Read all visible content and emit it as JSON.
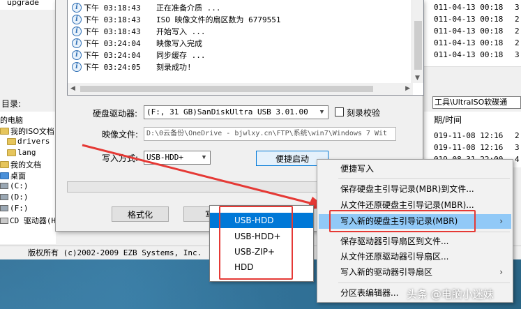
{
  "background_window": {
    "top_left_label": "upgrade",
    "dir_label": "目录:",
    "path_text": "工具\\UltraISO软碟通",
    "files_top": [
      {
        "date": "011-04-13 00:18",
        "cut": "3"
      },
      {
        "date": "011-04-13 00:18",
        "cut": "2"
      },
      {
        "date": "011-04-13 00:18",
        "cut": "2"
      },
      {
        "date": "011-04-13 00:18",
        "cut": "2"
      },
      {
        "date": "011-04-13 00:18",
        "cut": "3"
      }
    ],
    "col_date": "期/时间",
    "files_bottom": [
      {
        "date": "019-11-08 12:16",
        "cut": "2"
      },
      {
        "date": "019-11-08 12:16",
        "cut": "3"
      },
      {
        "date": "019-08-31 22:00",
        "cut": "4"
      }
    ],
    "tree": [
      {
        "label": "的电脑",
        "icon": "computer-icon"
      },
      {
        "label": "我的ISO文档",
        "icon": "folder-icon"
      },
      {
        "label": "drivers",
        "icon": "folder-icon"
      },
      {
        "label": "lang",
        "icon": "folder-icon"
      },
      {
        "label": "我的文档",
        "icon": "folder-icon"
      },
      {
        "label": "桌面",
        "icon": "desktop-icon"
      },
      {
        "label": "(C:)",
        "icon": "drive-icon"
      },
      {
        "label": "(D:)",
        "icon": "drive-icon"
      },
      {
        "label": "(F:)",
        "icon": "drive-icon"
      },
      {
        "label": "CD 驱动器(H",
        "icon": "cd-drive-icon"
      }
    ],
    "status": "版权所有 (c)2002-2009 EZB Systems, Inc."
  },
  "dialog": {
    "log": [
      {
        "time": "下午 03:18:43",
        "msg": "正在准备介质 ..."
      },
      {
        "time": "下午 03:18:43",
        "msg": "ISO 映像文件的扇区数为 6779551"
      },
      {
        "time": "下午 03:18:43",
        "msg": "开始写入 ..."
      },
      {
        "time": "下午 03:24:04",
        "msg": "映像写入完成"
      },
      {
        "time": "下午 03:24:04",
        "msg": "同步缓存 ..."
      },
      {
        "time": "下午 03:24:05",
        "msg": "刻录成功!"
      }
    ],
    "drive_label": "硬盘驱动器:",
    "drive_value": "(F:, 31 GB)SanDiskUltra USB 3.01.00",
    "verify_label": "刻录校验",
    "image_label": "映像文件:",
    "image_value": "D:\\0云备份\\OneDrive - bjwlxy.cn\\FTP\\系统\\win7\\Windows 7 Wit",
    "write_mode_label": "写入方式:",
    "write_mode_value": "USB-HDD+",
    "quick_boot_btn": "便捷启动",
    "format_btn": "格式化",
    "write_btn_partial": "写"
  },
  "write_mode_popup": {
    "options": [
      "USB-HDD",
      "USB-HDD+",
      "USB-ZIP+",
      "HDD"
    ],
    "selected": "USB-HDD"
  },
  "context_menu": {
    "items": [
      {
        "label": "便捷写入",
        "submenu": false
      },
      {
        "label": "保存硬盘主引导记录(MBR)到文件...",
        "submenu": false
      },
      {
        "label": "从文件还原硬盘主引导记录(MBR)...",
        "submenu": false
      },
      {
        "label": "写入新的硬盘主引导记录(MBR)",
        "submenu": true
      },
      {
        "label": "保存驱动器引导扇区到文件...",
        "submenu": false
      },
      {
        "label": "从文件还原驱动器引导扇区...",
        "submenu": false
      },
      {
        "label": "写入新的驱动器引导扇区",
        "submenu": true
      },
      {
        "label": "分区表编辑器...",
        "submenu": false
      }
    ],
    "highlighted": "写入新的硬盘主引导记录(MBR)",
    "submenu_arrow": "›"
  },
  "watermark": "头条 @电脑小迷妹",
  "colors": {
    "annotation_red": "#e53935",
    "selection_blue": "#0078d7",
    "menu_highlight": "#91c9f7"
  }
}
